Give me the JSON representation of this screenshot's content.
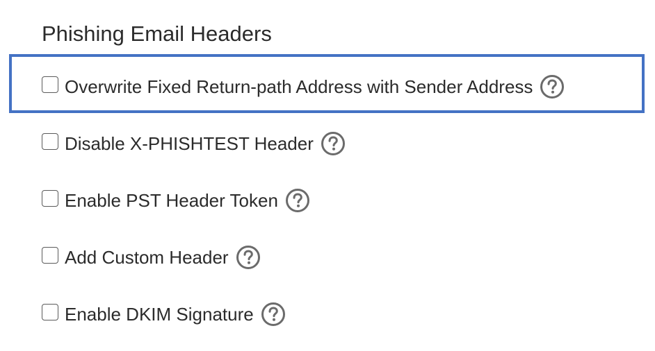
{
  "section": {
    "title": "Phishing Email Headers"
  },
  "options": [
    {
      "label": "Overwrite Fixed Return-path Address with Sender Address",
      "checked": false,
      "help_icon": "question-circle-icon"
    },
    {
      "label": "Disable X-PHISHTEST Header",
      "checked": false,
      "help_icon": "question-circle-icon"
    },
    {
      "label": "Enable PST Header Token",
      "checked": false,
      "help_icon": "question-circle-icon"
    },
    {
      "label": "Add Custom Header",
      "checked": false,
      "help_icon": "question-circle-icon"
    },
    {
      "label": "Enable DKIM Signature",
      "checked": false,
      "help_icon": "question-circle-icon"
    }
  ],
  "colors": {
    "focus_border": "#4472c4",
    "help_icon": "#6b6b6b",
    "text": "#2b2b2b"
  }
}
